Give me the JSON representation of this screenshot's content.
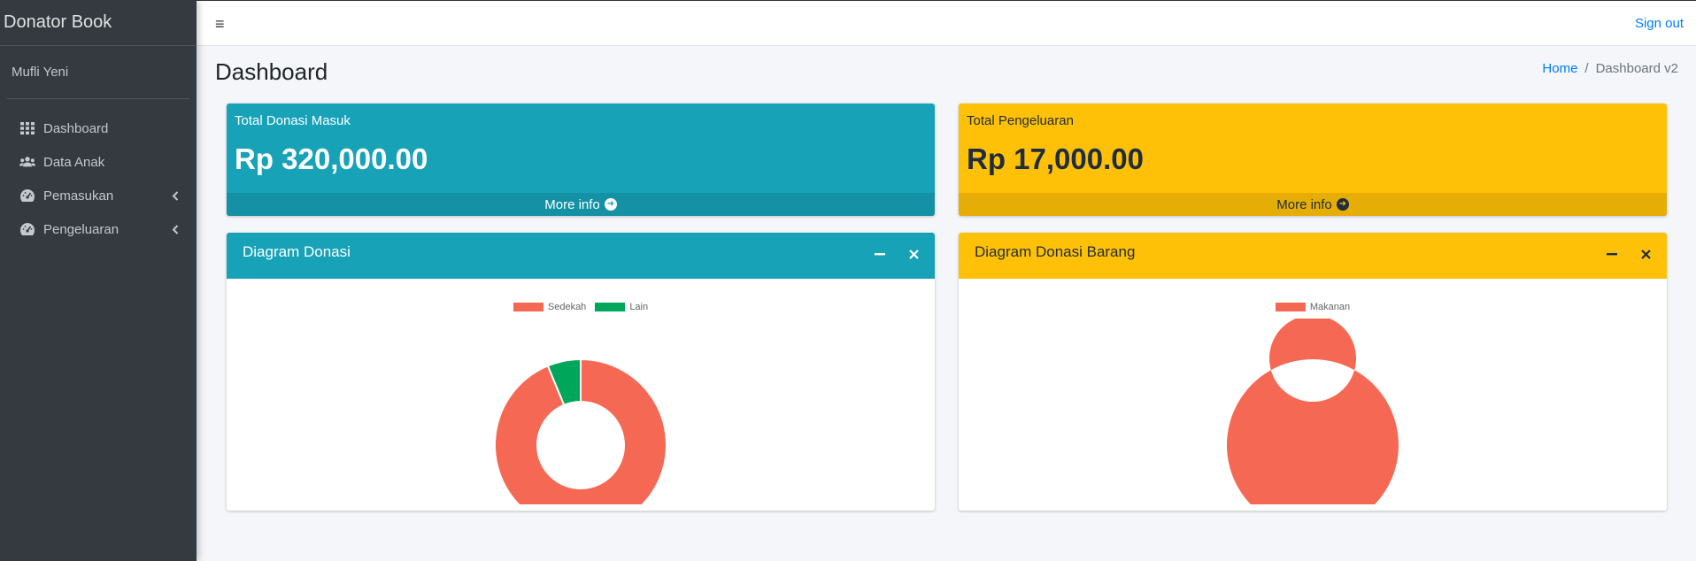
{
  "sidebar": {
    "brand": "Donator Book",
    "user": "Mufli Yeni",
    "items": [
      {
        "label": "Dashboard",
        "icon": "grid-icon"
      },
      {
        "label": "Data Anak",
        "icon": "users-icon"
      },
      {
        "label": "Pemasukan",
        "icon": "gauge-icon",
        "has_submenu": true
      },
      {
        "label": "Pengeluaran",
        "icon": "gauge-icon",
        "has_submenu": true
      }
    ]
  },
  "topbar": {
    "menu_icon": "≡",
    "signout": "Sign out"
  },
  "header": {
    "title": "Dashboard",
    "breadcrumb": {
      "home": "Home",
      "separator": "/",
      "current": "Dashboard v2"
    }
  },
  "boxes": {
    "donasi": {
      "label": "Total Donasi Masuk",
      "value": "Rp 320,000.00",
      "footer": "More info",
      "color": "#17a2b8"
    },
    "pengeluaran": {
      "label": "Total Pengeluaran",
      "value": "Rp 17,000.00",
      "footer": "More info",
      "color": "#ffc107"
    }
  },
  "cards": {
    "donasi": {
      "title": "Diagram Donasi"
    },
    "barang": {
      "title": "Diagram Donasi Barang"
    }
  },
  "chart_data": [
    {
      "type": "pie",
      "variant": "doughnut",
      "labels": [
        "Sedekah",
        "Lain"
      ],
      "values": [
        300000,
        20000
      ],
      "colors": [
        "#f56954",
        "#00a65a"
      ],
      "legend_position": "top"
    },
    {
      "type": "pie",
      "variant": "doughnut",
      "labels": [
        "Makanan"
      ],
      "values": [
        1
      ],
      "colors": [
        "#f56954"
      ],
      "legend_position": "top"
    }
  ]
}
